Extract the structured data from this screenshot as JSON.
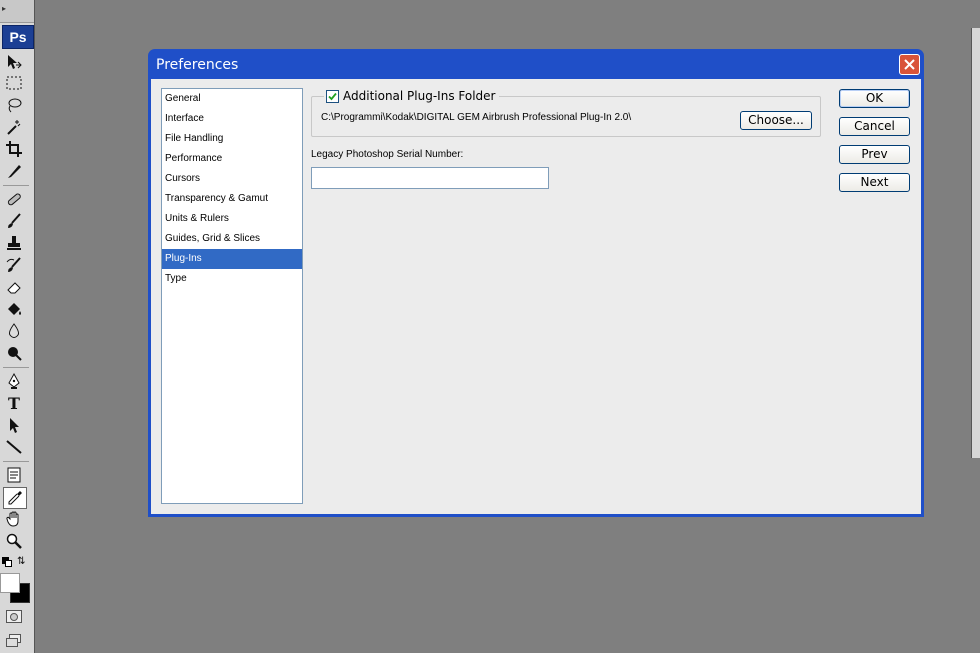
{
  "app": {
    "logo": "Ps"
  },
  "toolbar": {
    "tools": [
      {
        "name": "move-tool-icon"
      },
      {
        "name": "marquee-tool-icon"
      },
      {
        "name": "lasso-tool-icon"
      },
      {
        "name": "magic-wand-tool-icon"
      },
      {
        "name": "crop-tool-icon"
      },
      {
        "name": "slice-tool-icon"
      },
      {
        "name": "healing-brush-tool-icon"
      },
      {
        "name": "brush-tool-icon"
      },
      {
        "name": "clone-stamp-tool-icon"
      },
      {
        "name": "history-brush-tool-icon"
      },
      {
        "name": "eraser-tool-icon"
      },
      {
        "name": "paint-bucket-tool-icon"
      },
      {
        "name": "blur-tool-icon"
      },
      {
        "name": "dodge-tool-icon"
      },
      {
        "name": "pen-tool-icon"
      },
      {
        "name": "type-tool-icon"
      },
      {
        "name": "path-selection-tool-icon"
      },
      {
        "name": "line-tool-icon"
      },
      {
        "name": "notes-tool-icon"
      },
      {
        "name": "eyedropper-tool-icon"
      },
      {
        "name": "hand-tool-icon"
      },
      {
        "name": "zoom-tool-icon"
      }
    ],
    "type_tool_glyph": "T",
    "foreground_color": "#ffffff",
    "background_color": "#000000"
  },
  "dialog": {
    "title": "Preferences",
    "categories": [
      "General",
      "Interface",
      "File Handling",
      "Performance",
      "Cursors",
      "Transparency & Gamut",
      "Units & Rulers",
      "Guides, Grid & Slices",
      "Plug-Ins",
      "Type"
    ],
    "selected_category": "Plug-Ins",
    "plugins": {
      "additional_folder_label": "Additional Plug-Ins Folder",
      "additional_folder_checked": true,
      "folder_path": "C:\\Programmi\\Kodak\\DIGITAL GEM Airbrush Professional Plug-In 2.0\\",
      "choose_label": "Choose...",
      "serial_label": "Legacy Photoshop Serial Number:",
      "serial_value": ""
    },
    "buttons": {
      "ok": "OK",
      "cancel": "Cancel",
      "prev": "Prev",
      "next": "Next"
    }
  },
  "colors": {
    "dialog_frame": "#1f4fc8",
    "selection": "#316ac5",
    "close_button": "#d9543a",
    "workspace": "#7f7f7f"
  }
}
